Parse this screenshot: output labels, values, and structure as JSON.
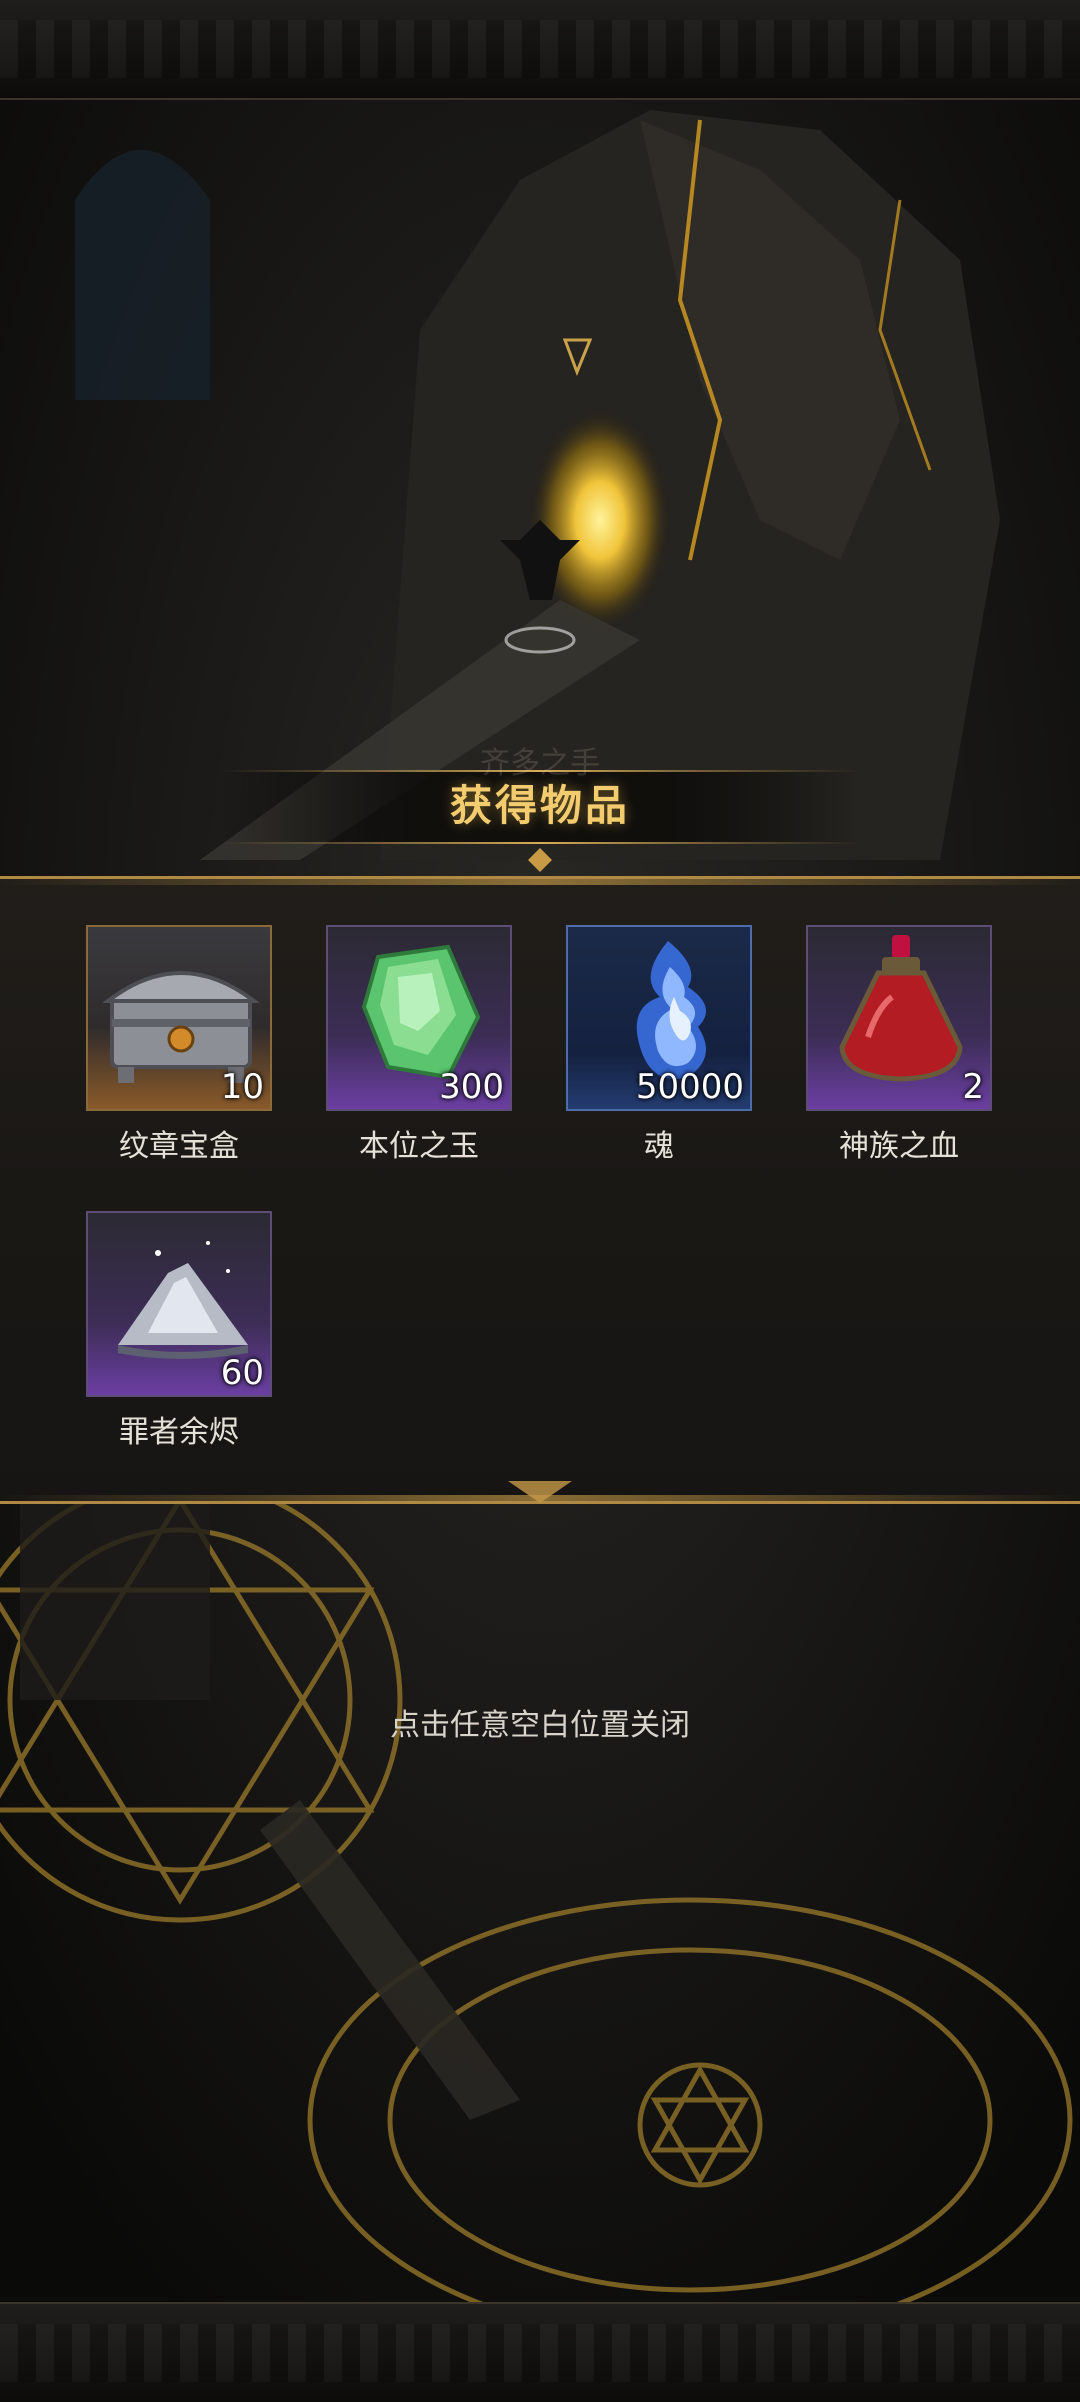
{
  "dialog": {
    "title": "获得物品",
    "items": [
      {
        "name": "纹章宝盒",
        "count": "10",
        "icon": "crest-treasure-chest-icon",
        "rarity_color": "#c98b3a"
      },
      {
        "name": "本位之玉",
        "count": "300",
        "icon": "green-crystal-icon",
        "rarity_color": "#7b46b8"
      },
      {
        "name": "魂",
        "count": "50000",
        "icon": "blue-soul-flame-icon",
        "rarity_color": "#4f7fd6"
      },
      {
        "name": "神族之血",
        "count": "2",
        "icon": "red-blood-potion-icon",
        "rarity_color": "#7b46b8"
      },
      {
        "name": "罪者余烬",
        "count": "60",
        "icon": "sinner-ember-pile-icon",
        "rarity_color": "#7b46b8"
      }
    ]
  },
  "hint": "点击任意空白位置关闭",
  "background_watermark": "齐多之手",
  "colors": {
    "accent_gold": "#f2cc6e",
    "panel_border": "#b08a45"
  }
}
